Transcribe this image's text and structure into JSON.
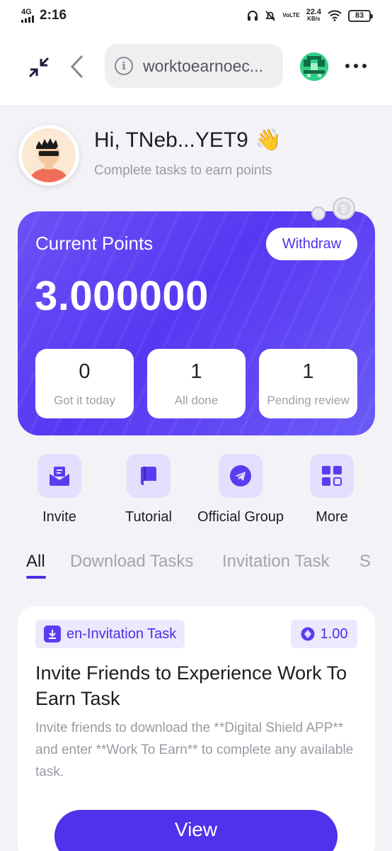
{
  "status_bar": {
    "network": "4G",
    "time": "2:16",
    "volte": "VoLTE",
    "speed_value": "22.4",
    "speed_unit": "KB/s",
    "battery": "83"
  },
  "browser": {
    "url": "worktoearnoec..."
  },
  "greeting": {
    "title": "Hi, TNeb...YET9",
    "emoji": "👋",
    "subtitle": "Complete tasks to earn points"
  },
  "points_card": {
    "label": "Current Points",
    "withdraw_label": "Withdraw",
    "value": "3.000000",
    "stats": [
      {
        "value": "0",
        "label": "Got it today"
      },
      {
        "value": "1",
        "label": "All done"
      },
      {
        "value": "1",
        "label": "Pending review"
      }
    ]
  },
  "quick_actions": [
    {
      "label": "Invite",
      "icon": "mail-icon"
    },
    {
      "label": "Tutorial",
      "icon": "book-icon"
    },
    {
      "label": "Official Group",
      "icon": "telegram-icon"
    },
    {
      "label": "More",
      "icon": "grid-icon"
    }
  ],
  "tabs": [
    {
      "label": "All",
      "active": true
    },
    {
      "label": "Download Tasks",
      "active": false
    },
    {
      "label": "Invitation Task",
      "active": false
    },
    {
      "label": "S",
      "active": false
    }
  ],
  "task": {
    "tag": "en-Invitation Task",
    "reward": "1.00",
    "title": "Invite Friends to Experience Work To Earn Task",
    "description": "Invite friends to download the **Digital Shield APP** and enter **Work To Earn** to complete any available task.",
    "button_label": "View"
  },
  "colors": {
    "accent": "#4b2fe6",
    "card_bg": "#5738f2",
    "page_bg": "#f3f3f7"
  }
}
